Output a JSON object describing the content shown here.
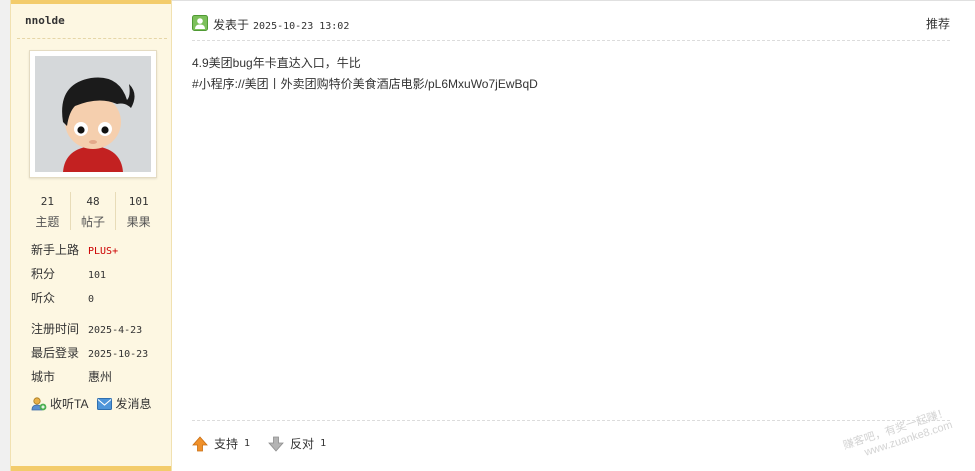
{
  "user": {
    "name": "nnolde",
    "stats": [
      {
        "value": "21",
        "label": "主题"
      },
      {
        "value": "48",
        "label": "帖子"
      },
      {
        "value": "101",
        "label": "果果"
      }
    ],
    "info_group1": [
      {
        "key": "新手上路",
        "value": "PLUS+"
      },
      {
        "key": "积分",
        "value": "101"
      },
      {
        "key": "听众",
        "value": "0"
      }
    ],
    "info_group2": [
      {
        "key": "注册时间",
        "value": "2025-4-23"
      },
      {
        "key": "最后登录",
        "value": "2025-10-23"
      },
      {
        "key": "城市",
        "value": "惠州"
      }
    ],
    "actions": {
      "follow": "收听TA",
      "message": "发消息"
    }
  },
  "post": {
    "posted_label": "发表于",
    "posted_time": "2025-10-23 13:02",
    "recommend": "推荐",
    "lines": [
      "4.9美团bug年卡直达入口，牛比",
      "#小程序://美团丨外卖团购特价美食酒店电影/pL6MxuWo7jEwBqD"
    ],
    "support_label": "支持",
    "support_count": "1",
    "oppose_label": "反对",
    "oppose_count": "1"
  },
  "watermark": {
    "line1": "赚客吧，有奖一起赚！",
    "line2": "www.zuanke8.com"
  },
  "colors": {
    "side_bg": "#fdf7e2",
    "side_bar": "#f3cc6b",
    "plus": "#cc0000",
    "support_arrow": "#f0912b",
    "oppose_arrow": "#a8a8a8"
  }
}
